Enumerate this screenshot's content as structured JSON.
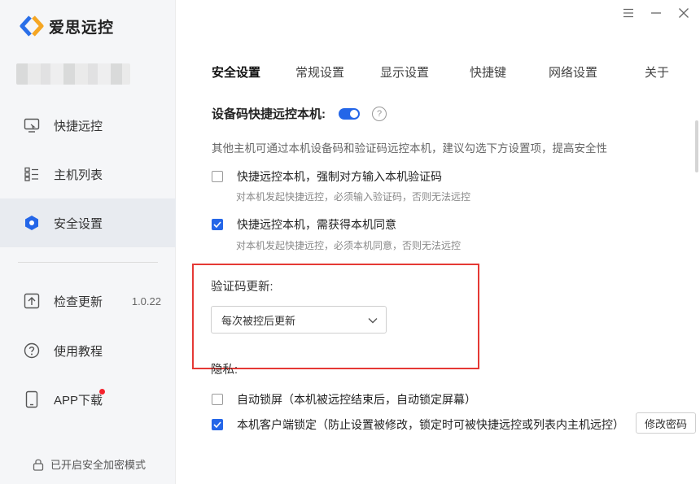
{
  "app": {
    "name": "爱思远控"
  },
  "sidebar": {
    "items": [
      {
        "label": "快捷远控",
        "icon": "remote-desktop-icon"
      },
      {
        "label": "主机列表",
        "icon": "list-icon"
      },
      {
        "label": "安全设置",
        "icon": "shield-icon",
        "active": true
      },
      {
        "label": "检查更新",
        "icon": "upload-icon",
        "version": "1.0.22"
      },
      {
        "label": "使用教程",
        "icon": "help-circle-icon"
      },
      {
        "label": "APP下载",
        "icon": "phone-icon",
        "badge_dot": true
      }
    ],
    "footer": {
      "label": "已开启安全加密模式",
      "icon": "lock-icon"
    }
  },
  "window_controls": {
    "menu": "menu-icon",
    "minimize": "minimize-icon",
    "close": "close-icon"
  },
  "tabs": [
    {
      "label": "安全设置",
      "active": true
    },
    {
      "label": "常规设置"
    },
    {
      "label": "显示设置"
    },
    {
      "label": "快捷键"
    },
    {
      "label": "网络设置"
    },
    {
      "label": "关于"
    }
  ],
  "security": {
    "quick_remote_title": "设备码快捷远控本机:",
    "quick_remote_enabled": true,
    "help_glyph": "?",
    "description": "其他主机可通过本机设备码和验证码远控本机，建议勾选下方设置项，提高安全性",
    "options": [
      {
        "label": "快捷远控本机，强制对方输入本机验证码",
        "sub": "对本机发起快捷远控，必须输入验证码，否则无法远控",
        "checked": false
      },
      {
        "label": "快捷远控本机，需获得本机同意",
        "sub": "对本机发起快捷远控，必须本机同意，否则无法远控",
        "checked": true
      }
    ],
    "code_update": {
      "label": "验证码更新:",
      "selected": "每次被控后更新"
    },
    "privacy": {
      "label": "隐私:",
      "options": [
        {
          "label": "自动锁屏（本机被远控结束后，自动锁定屏幕）",
          "checked": false
        },
        {
          "label": "本机客户端锁定（防止设置被修改，锁定时可被快捷远控或列表内主机远控）",
          "checked": true
        }
      ],
      "change_password_label": "修改密码"
    }
  },
  "colors": {
    "accent": "#2466e8",
    "highlight_box": "#e53935",
    "badge": "#f5222d"
  }
}
